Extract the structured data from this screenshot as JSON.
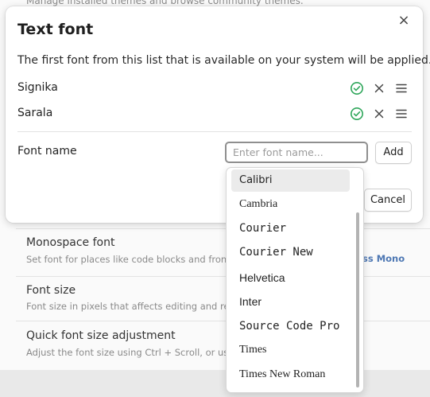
{
  "background": {
    "top_text": "Manage installed themes and browse community themes.",
    "rows": [
      {
        "name": "Monospace font",
        "desc": "Set font for places like code blocks and frontmatte",
        "link": "ss Mono"
      },
      {
        "name": "Font size",
        "desc": "Font size in pixels that affects editing and reading"
      },
      {
        "name": "Quick font size adjustment",
        "desc": "Adjust the font size using Ctrl + Scroll, or using the"
      }
    ]
  },
  "modal": {
    "title": "Text font",
    "description": "The first font from this list that is available on your system will be applied.",
    "close_icon": "×",
    "fonts": [
      {
        "name": "Signika",
        "status": "available"
      },
      {
        "name": "Sarala",
        "status": "available"
      }
    ],
    "font_name_label": "Font name",
    "font_name_placeholder": "Enter font name...",
    "add_label": "Add",
    "cancel_label": "Cancel"
  },
  "dropdown": {
    "items": [
      "Calibri",
      "Cambria",
      "Courier",
      "Courier New",
      "Helvetica",
      "Inter",
      "Source Code Pro",
      "Times",
      "Times New Roman"
    ],
    "selected": "Calibri"
  },
  "colors": {
    "check": "#2ea65a",
    "accent_link": "#4d77b3"
  }
}
